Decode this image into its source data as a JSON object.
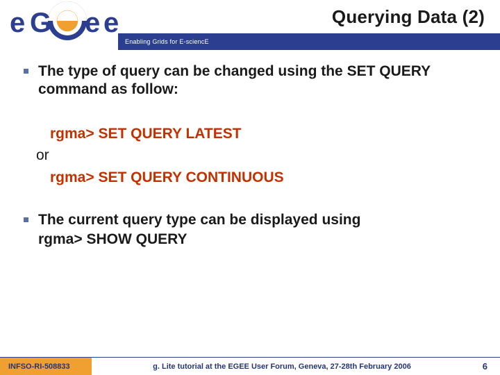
{
  "header": {
    "title": "Querying Data (2)",
    "tagline": "Enabling Grids for E-sciencE",
    "logo_text_top": "e",
    "logo_text_mid": "ee"
  },
  "bullets": {
    "b1": "The type of query can be changed using the SET QUERY command as follow:",
    "cmd1": "rgma> SET QUERY LATEST",
    "or": "or",
    "cmd2": "rgma> SET QUERY CONTINUOUS",
    "b2": "The current query type can be displayed using",
    "show": "rgma> SHOW QUERY"
  },
  "footer": {
    "left": "INFSO-RI-508833",
    "center": "g. Lite tutorial at the EGEE User Forum, Geneva, 27-28th February 2006",
    "page": "6"
  },
  "colors": {
    "blue": "#2c3e8f",
    "orange": "#f0a030",
    "cmd": "#c23200"
  }
}
